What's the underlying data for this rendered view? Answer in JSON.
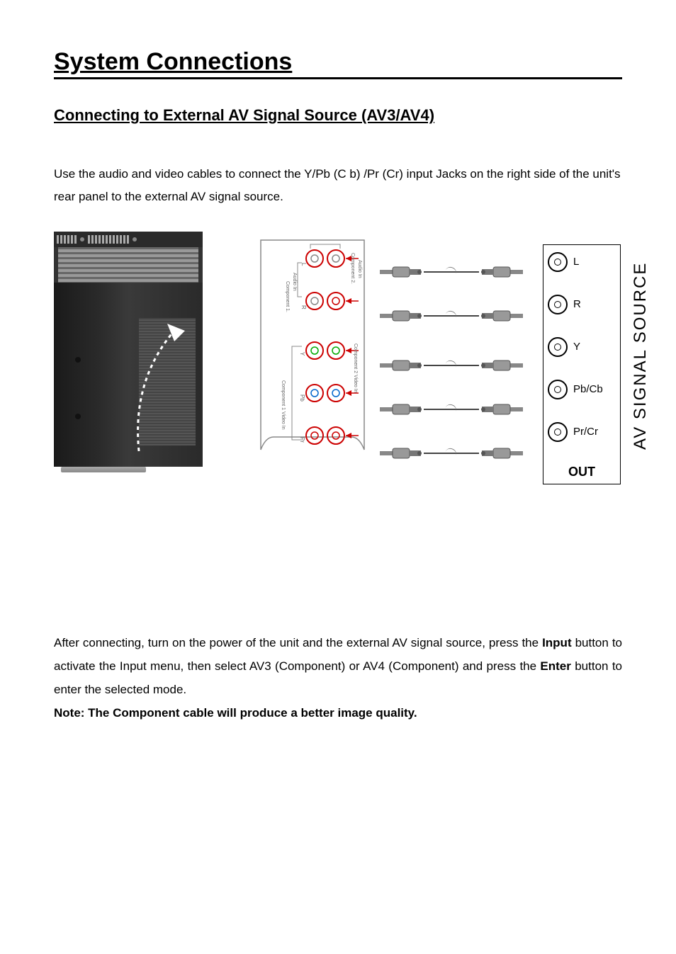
{
  "title": "System Connections",
  "subtitle": "Connecting to External AV Signal Source (AV3/AV4)",
  "intro": "Use the audio and video cables to connect the Y/Pb (C b) /Pr (Cr) input Jacks on the right side of the unit's rear panel to the external AV signal source.",
  "diagram": {
    "panel_labels": {
      "audio_group_1": "Component 2. Audio In",
      "audio_group_2": "Component 1. Audio In",
      "video_group_1": "Component 2 Video In",
      "video_group_2": "Component 1 Video In",
      "row_labels": [
        "L",
        "R",
        "Y",
        "Pb",
        "Pr"
      ]
    },
    "out_box": {
      "rows": [
        {
          "label": "L"
        },
        {
          "label": "R"
        },
        {
          "label": "Y"
        },
        {
          "label": "Pb/Cb"
        },
        {
          "label": "Pr/Cr"
        }
      ],
      "title": "OUT"
    },
    "av_source_label": "AV SIGNAL SOURCE"
  },
  "after_text_1": "After connecting, turn on the power of the unit and the external AV signal source, press the ",
  "after_bold_1": "Input",
  "after_text_2": " button to activate the Input menu, then select AV3 (Component) or AV4 (Component) and press the ",
  "after_bold_2": "Enter",
  "after_text_3": " button to enter the selected mode.",
  "note": "Note: The Component cable will produce a better image quality."
}
